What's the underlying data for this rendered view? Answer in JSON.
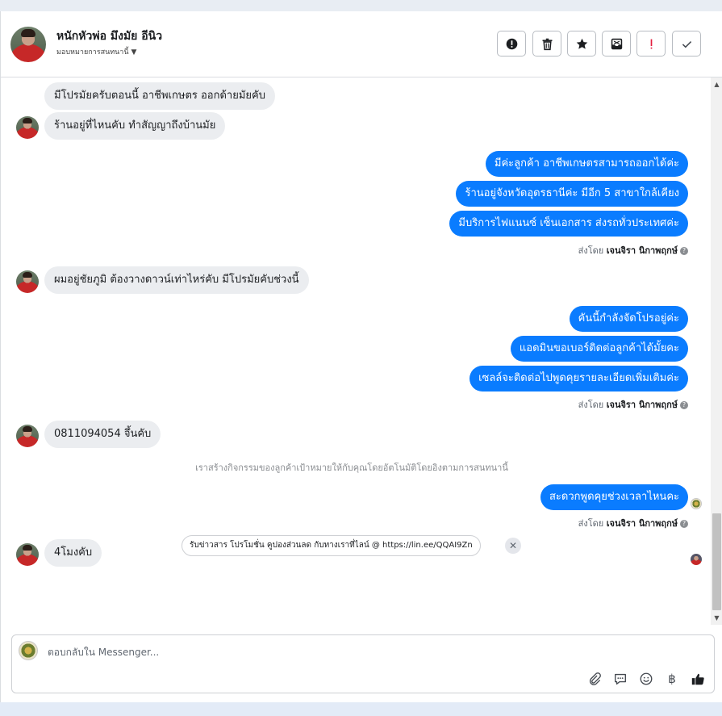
{
  "header": {
    "contact_name": "หนักหัวพ่อ มึงมัย อีนิว",
    "assign_label": "มอบหมายการสนทนานี้",
    "actions": [
      {
        "name": "spam-alert-button",
        "icon": "exclamation-circle-icon"
      },
      {
        "name": "delete-button",
        "icon": "trash-icon"
      },
      {
        "name": "star-button",
        "icon": "star-icon"
      },
      {
        "name": "archive-button",
        "icon": "inbox-archive-icon"
      },
      {
        "name": "follow-up-button",
        "icon": "exclamation-mark-icon"
      },
      {
        "name": "mark-done-button",
        "icon": "check-icon"
      }
    ]
  },
  "messages": {
    "m1": "มีโปรมัยครับตอนนี้ อาชีพเกษตร ออกด้ายมัยคับ",
    "m2": "ร้านอยู่ที่ไหนคับ ทำสัญญาถึงบ้านมัย",
    "r1": "มีค่ะลูกค้า อาชีพเกษตรสามารถออกได้ค่ะ",
    "r2": "ร้านอยู่จังหวัดอุดรธานีค่ะ มีอีก 5 สาขาใกล้เคียง",
    "r3": "มีบริการไฟแนนซ์ เซ็นเอกสาร ส่งรถทั่วประเทศค่ะ",
    "m3": "ผมอยู่ชัยภูมิ ต้องวางดาวน์เท่าไหร่คับ มีโปรมัยคับช่วงนี้",
    "r4": "คันนี้กำลังจัดโปรอยู่ค่ะ",
    "r5": "แอดมินขอเบอร์ติดต่อลูกค้าได้มั้ยคะ",
    "r6": "เซลล์จะติดต่อไปพูดคุยรายละเอียดเพิ่มเติมค่ะ",
    "m4": "0811094054 จึ้นคับ",
    "system_note": "เราสร้างกิจกรรมของลูกค้าเป้าหมายให้กับคุณโดยอัตโนมัติโดยอิงตามการสนทนานี้",
    "r7": "สะดวกพูดคุยช่วงเวลาไหนคะ",
    "m5": "4โมงคับ"
  },
  "sent_by": {
    "prefix": "ส่งโดย",
    "agent": "เจนจิรา นิกาพฤกษ์"
  },
  "suggestion_chip": "รับข่าวสาร โปรโมชั่น คูปองส่วนลด กับทางเราที่ไลน์ @ https://lin.ee/QQAI9Zn",
  "composer": {
    "placeholder": "ตอบกลับใน Messenger...",
    "tools": [
      "attachment-icon",
      "saved-reply-icon",
      "emoji-icon",
      "baht-payment-icon",
      "thumbs-up-icon"
    ]
  }
}
